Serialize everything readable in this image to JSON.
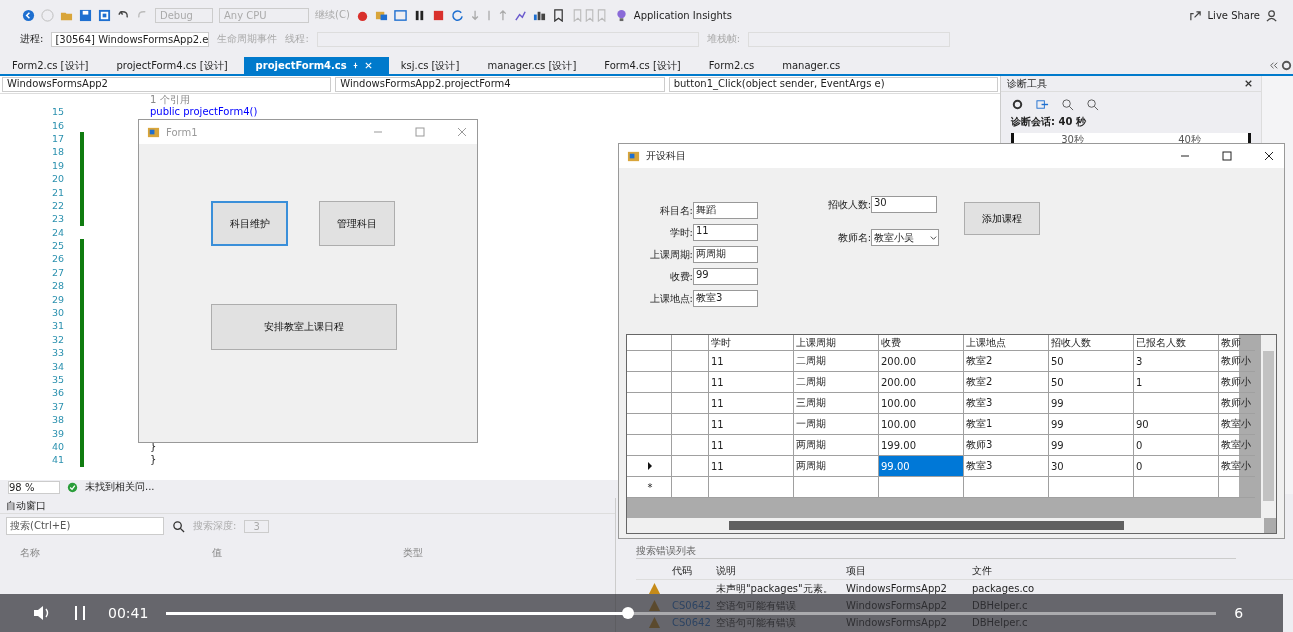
{
  "toolbar": {
    "config": "Debug",
    "platform": "Any CPU",
    "continue": "继续(C)",
    "insights": "Application Insights",
    "live_share": "Live Share"
  },
  "process_bar": {
    "label": "进程:",
    "value": "[30564] WindowsFormsApp2.e",
    "lifecycle": "生命周期事件",
    "thread": "线程:",
    "stack": "堆栈帧:"
  },
  "doc_tabs": [
    {
      "label": "Form2.cs [设计]",
      "selected": false
    },
    {
      "label": "projectForm4.cs [设计]",
      "selected": false
    },
    {
      "label": "projectForm4.cs",
      "selected": true
    },
    {
      "label": "ksj.cs [设计]",
      "selected": false
    },
    {
      "label": "manager.cs [设计]",
      "selected": false
    },
    {
      "label": "Form4.cs [设计]",
      "selected": false
    },
    {
      "label": "Form2.cs",
      "selected": false
    },
    {
      "label": "manager.cs",
      "selected": false
    }
  ],
  "nav": [
    "WindowsFormsApp2",
    "WindowsFormsApp2.projectForm4",
    "button1_Click(object sender, EventArgs e)"
  ],
  "editor": {
    "codelens": "1 个引用",
    "lines": [
      {
        "number": "15",
        "text": "public projectForm4()",
        "changed": false
      },
      {
        "number": "16",
        "changed": false
      },
      {
        "number": "17",
        "changed": true
      },
      {
        "number": "18",
        "changed": true
      },
      {
        "number": "19",
        "changed": true
      },
      {
        "number": "20",
        "changed": true
      },
      {
        "number": "21",
        "changed": true
      },
      {
        "number": "22",
        "changed": true
      },
      {
        "number": "23",
        "changed": true
      },
      {
        "number": "24",
        "changed": false
      },
      {
        "number": "25",
        "changed": true
      },
      {
        "number": "26",
        "changed": true
      },
      {
        "number": "27",
        "changed": true
      },
      {
        "number": "28",
        "changed": true
      },
      {
        "number": "29",
        "changed": true
      },
      {
        "number": "30",
        "changed": true
      },
      {
        "number": "31",
        "changed": true
      },
      {
        "number": "32",
        "changed": true
      },
      {
        "number": "33",
        "changed": true
      },
      {
        "number": "34",
        "changed": true
      },
      {
        "number": "35",
        "changed": true
      },
      {
        "number": "36",
        "changed": true
      },
      {
        "number": "37",
        "changed": true
      },
      {
        "number": "38",
        "changed": true
      },
      {
        "number": "39",
        "changed": true
      },
      {
        "number": "40",
        "text": "}",
        "changed": true
      },
      {
        "number": "41",
        "text": "}",
        "changed": true
      }
    ],
    "zoom": "98 %",
    "status": "未找到相关问..."
  },
  "diagnostics": {
    "title": "诊断工具",
    "session": "诊断会话: 40 秒",
    "ticks": [
      "30秒",
      "40秒"
    ]
  },
  "form1": {
    "title": "Form1",
    "buttons": [
      {
        "label": "科目维护",
        "focused": true
      },
      {
        "label": "管理科目",
        "focused": false
      },
      {
        "label": "安排教室上课日程",
        "focused": false
      }
    ]
  },
  "course_form": {
    "title": "开设科目",
    "fields": [
      {
        "label": "科目名:",
        "value": "舞蹈"
      },
      {
        "label": "学时:",
        "value": "11"
      },
      {
        "label": "上课周期:",
        "value": "两周期"
      },
      {
        "label": "收费:",
        "value": "99"
      },
      {
        "label": "上课地点:",
        "value": "教室3"
      }
    ],
    "capacity": {
      "label": "招收人数:",
      "value": "30"
    },
    "teacher": {
      "label": "教师名:",
      "value": "教室小吴"
    },
    "add_button": "添加课程",
    "grid": {
      "columns": [
        "学时",
        "上课周期",
        "收费",
        "上课地点",
        "招收人数",
        "已报名人数",
        "教师"
      ],
      "rows": [
        {
          "cells": [
            "11",
            "二周期",
            "200.00",
            "教室2",
            "50",
            "3",
            "教师小"
          ],
          "current": false,
          "fee_selected": false
        },
        {
          "cells": [
            "11",
            "二周期",
            "200.00",
            "教室2",
            "50",
            "1",
            "教师小"
          ],
          "current": false,
          "fee_selected": false
        },
        {
          "cells": [
            "11",
            "三周期",
            "100.00",
            "教室3",
            "99",
            null,
            "教师小"
          ],
          "current": false,
          "fee_selected": false
        },
        {
          "cells": [
            "11",
            "一周期",
            "100.00",
            "教室1",
            "99",
            "90",
            "教室小"
          ],
          "current": false,
          "fee_selected": false
        },
        {
          "cells": [
            "11",
            "两周期",
            "199.00",
            "教师3",
            "99",
            "0",
            "教室小"
          ],
          "current": false,
          "fee_selected": false
        },
        {
          "cells": [
            "11",
            "两周期",
            "99.00",
            "教室3",
            "30",
            "0",
            "教室小"
          ],
          "current": true,
          "fee_selected": true
        }
      ],
      "new_row_marker": "*"
    }
  },
  "auto_window": {
    "title": "自动窗口",
    "search_placeholder": "搜索(Ctrl+E)",
    "depth_label": "搜索深度:",
    "depth": "3",
    "columns": [
      "名称",
      "值",
      "类型"
    ]
  },
  "error_list": {
    "search_placeholder": "搜索错误列表",
    "columns": [
      "代码",
      "说明",
      "项目",
      "文件"
    ],
    "rows": [
      {
        "kind": "warning",
        "description": "未声明\"packages\"元素。",
        "project": "WindowsFormsApp2",
        "file": "packages.co"
      },
      {
        "kind": "warning",
        "code": "CS0642",
        "description": "空语句可能有错误",
        "project": "WindowsFormsApp2",
        "file": "DBHelper.c"
      },
      {
        "kind": "warning",
        "code": "CS0642",
        "description": "空语句可能有错误",
        "project": "WindowsFormsApp2",
        "file": "DBHelper.c"
      }
    ]
  },
  "video": {
    "playing": true,
    "time": "00:41",
    "level": 0.44,
    "end_time": "6"
  }
}
